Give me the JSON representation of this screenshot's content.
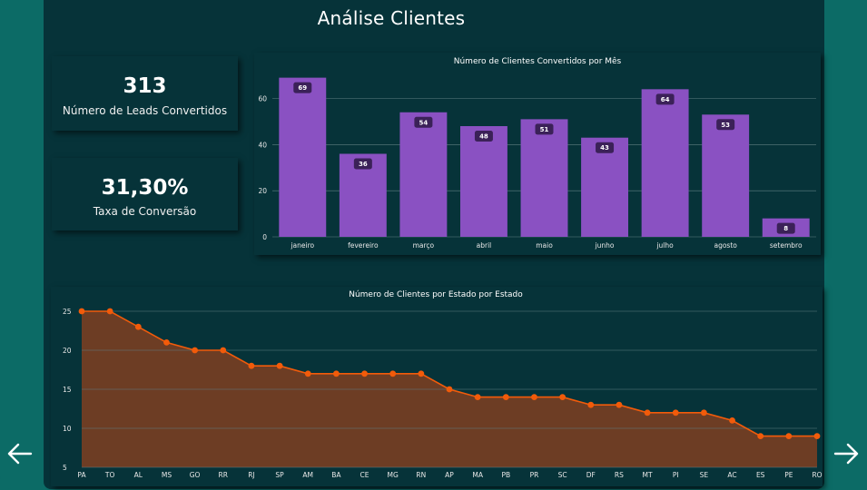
{
  "dashboard": {
    "title": "Análise Clientes"
  },
  "kpis": [
    {
      "value": "313",
      "label": "Número de Leads Convertidos"
    },
    {
      "value": "31,30%",
      "label": "Taxa de Conversão"
    }
  ],
  "colors": {
    "background": "#063339",
    "frame": "#0c6b66",
    "bar": "#8a51c2",
    "line": "#f25b0a",
    "area": "#6d3d24"
  },
  "navigation": {
    "prev_icon": "arrow-left-icon",
    "next_icon": "arrow-right-icon"
  },
  "chart_data": [
    {
      "type": "bar",
      "title": "Número de Clientes Convertidos por Mês",
      "categories": [
        "janeiro",
        "fevereiro",
        "março",
        "abril",
        "maio",
        "junho",
        "julho",
        "agosto",
        "setembro"
      ],
      "values": [
        69,
        36,
        54,
        48,
        51,
        43,
        64,
        53,
        8
      ],
      "yticks": [
        0,
        20,
        40,
        60
      ],
      "ylim": [
        0,
        72
      ],
      "grid": true,
      "data_labels": true
    },
    {
      "type": "area",
      "title": "Número de Clientes por Estado por Estado",
      "categories": [
        "PA",
        "TO",
        "AL",
        "MS",
        "GO",
        "RR",
        "RJ",
        "SP",
        "AM",
        "BA",
        "CE",
        "MG",
        "RN",
        "AP",
        "MA",
        "PB",
        "PR",
        "SC",
        "DF",
        "RS",
        "MT",
        "PI",
        "SE",
        "AC",
        "ES",
        "PE",
        "RO"
      ],
      "values": [
        25,
        25,
        23,
        21,
        20,
        20,
        18,
        18,
        17,
        17,
        17,
        17,
        17,
        15,
        14,
        14,
        14,
        14,
        13,
        13,
        12,
        12,
        12,
        11,
        9,
        9,
        9
      ],
      "yticks": [
        5,
        10,
        15,
        20,
        25
      ],
      "ylim": [
        5,
        25
      ],
      "grid": true
    }
  ]
}
